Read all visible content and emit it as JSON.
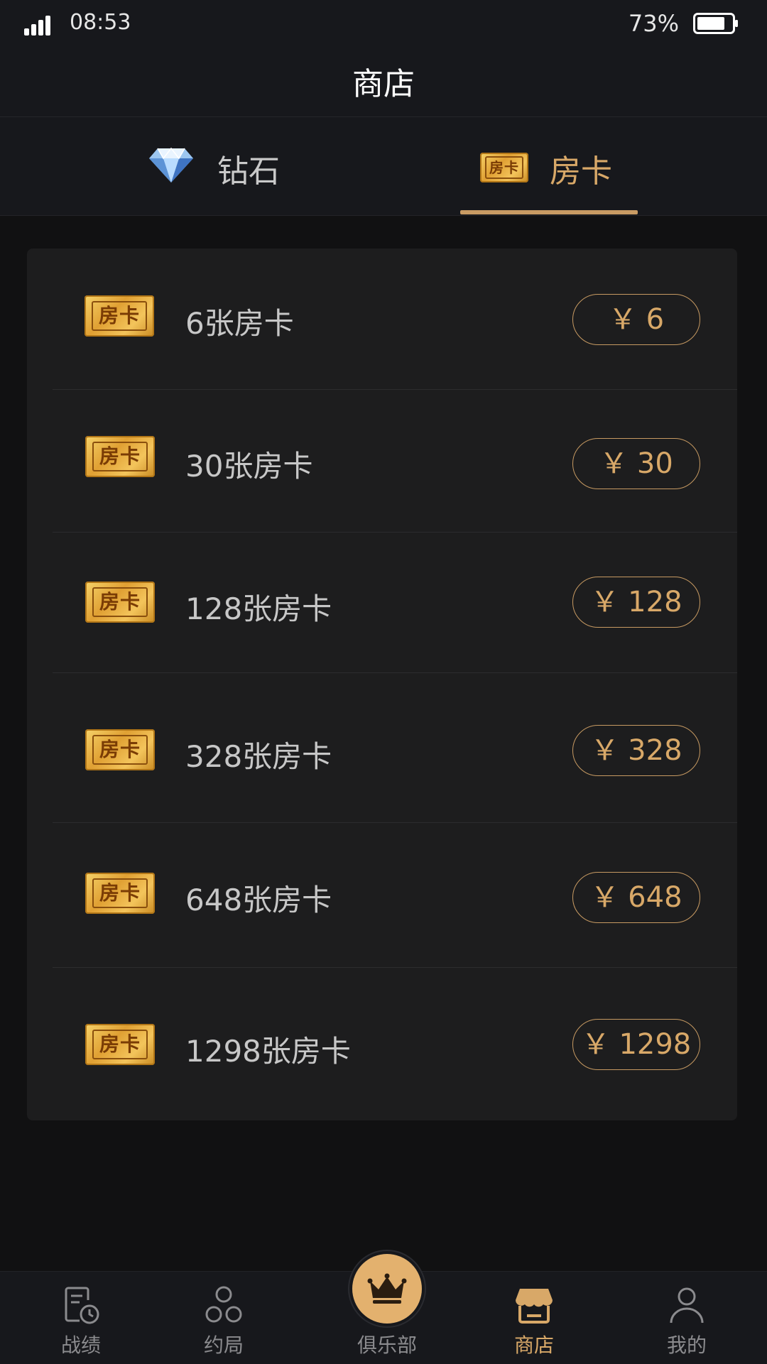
{
  "status_bar": {
    "time": "08:53",
    "battery": "73%"
  },
  "header": {
    "title": "商店"
  },
  "tabs": [
    {
      "label": "钻石",
      "icon": "diamond-icon",
      "active": false
    },
    {
      "label": "房卡",
      "icon": "room-card-icon",
      "card_text": "房卡",
      "active": true
    }
  ],
  "products": [
    {
      "name": "6张房卡",
      "price": "￥ 6",
      "card_text": "房卡"
    },
    {
      "name": "30张房卡",
      "price": "￥ 30",
      "card_text": "房卡"
    },
    {
      "name": "128张房卡",
      "price": "￥ 128",
      "card_text": "房卡"
    },
    {
      "name": "328张房卡",
      "price": "￥ 328",
      "card_text": "房卡"
    },
    {
      "name": "648张房卡",
      "price": "￥ 648",
      "card_text": "房卡"
    },
    {
      "name": "1298张房卡",
      "price": "￥ 1298",
      "card_text": "房卡"
    }
  ],
  "tabbar": [
    {
      "label": "战绩",
      "icon": "record-icon"
    },
    {
      "label": "约局",
      "icon": "circles-icon"
    },
    {
      "label": "俱乐部",
      "icon": "crown-icon"
    },
    {
      "label": "商店",
      "icon": "shop-icon",
      "active": true
    },
    {
      "label": "我的",
      "icon": "profile-icon"
    }
  ],
  "colors": {
    "accent": "#d8a868",
    "background": "#111112",
    "panel": "#1d1d1e",
    "bar": "#17181c"
  }
}
